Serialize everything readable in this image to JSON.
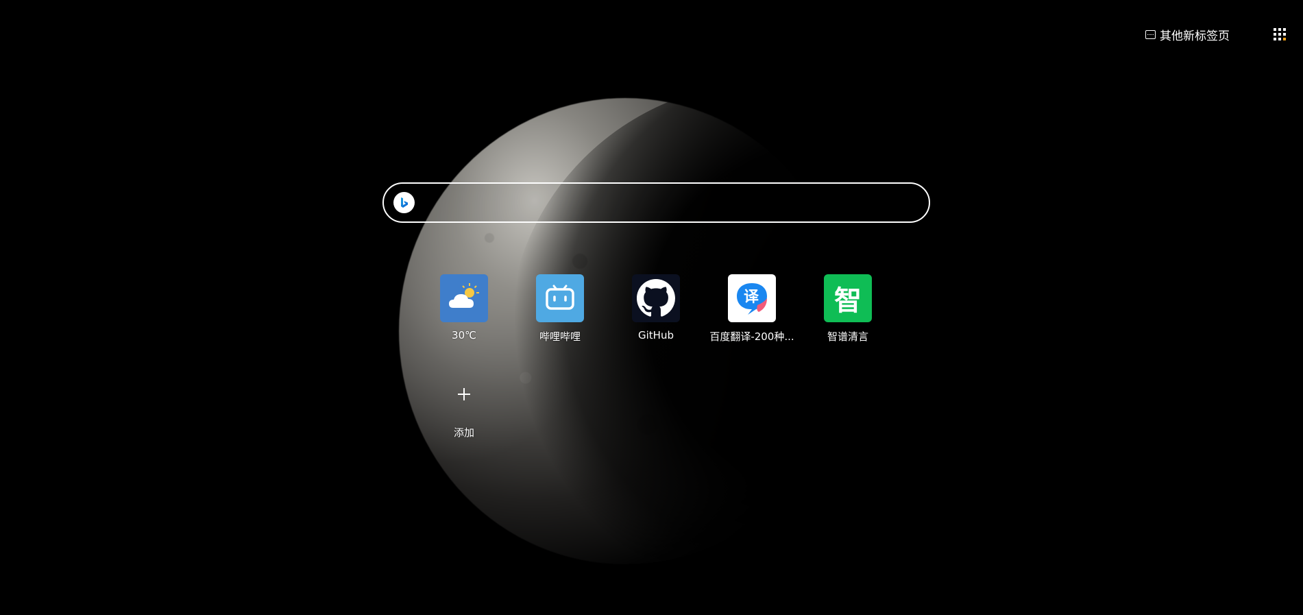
{
  "header": {
    "other_newtab_label": "其他新标签页",
    "other_newtab_icon": "newtab-icon",
    "apps_icon": "apps-grid-icon"
  },
  "search": {
    "engine_icon": "bing-logo-icon",
    "placeholder": "",
    "value": ""
  },
  "shortcuts": [
    {
      "label": "30℃",
      "icon": "weather-icon",
      "color": "#3f7ecb"
    },
    {
      "label": "哔哩哔哩",
      "icon": "bilibili-icon",
      "color": "#4fa9e3"
    },
    {
      "label": "GitHub",
      "icon": "github-icon",
      "color": "#0b1020"
    },
    {
      "label": "百度翻译-200种...",
      "icon": "baidu-translate-icon",
      "icon_text": "译",
      "color": "#ffffff"
    },
    {
      "label": "智谱清言",
      "icon": "zhipu-icon",
      "icon_text": "智",
      "color": "#0fbd55"
    }
  ],
  "add_tile": {
    "label": "添加",
    "icon": "plus-icon"
  }
}
